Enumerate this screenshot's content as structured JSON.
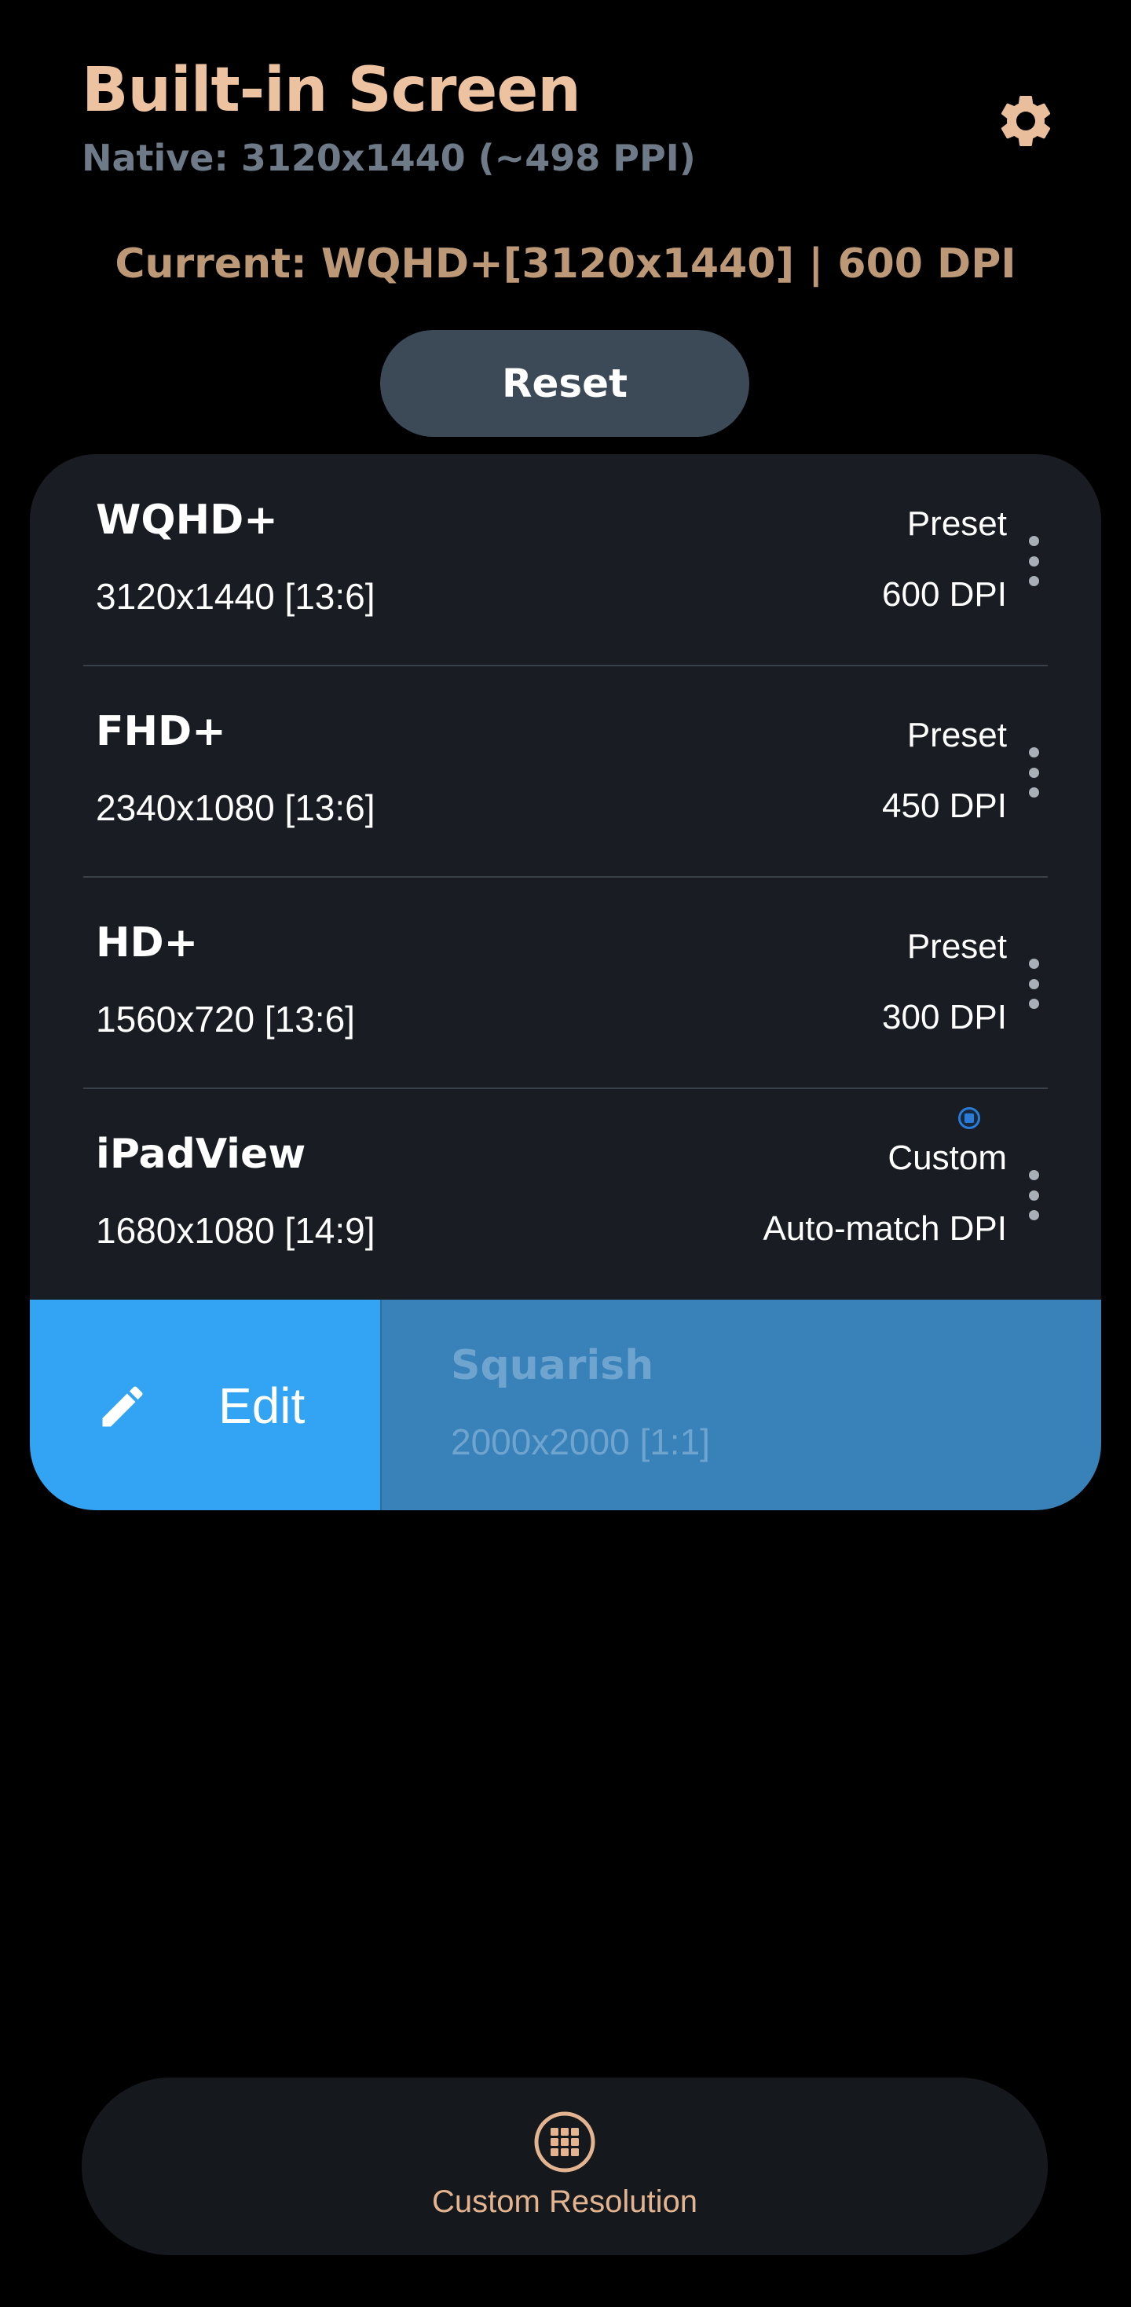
{
  "header": {
    "title": "Built-in Screen",
    "native": "Native: 3120x1440 (~498 PPI)",
    "settings_icon": "gear-icon"
  },
  "current": "Current: WQHD+[3120x1440] | 600 DPI",
  "reset_label": "Reset",
  "resolutions": [
    {
      "name": "WQHD+",
      "resolution": "3120x1440 [13:6]",
      "kind": "Preset",
      "dpi": "600 DPI"
    },
    {
      "name": "FHD+",
      "resolution": "2340x1080 [13:6]",
      "kind": "Preset",
      "dpi": "450 DPI"
    },
    {
      "name": "HD+",
      "resolution": "1560x720 [13:6]",
      "kind": "Preset",
      "dpi": "300 DPI"
    },
    {
      "name": "iPadView",
      "resolution": "1680x1080 [14:9]",
      "kind": "Custom",
      "dpi": "Auto-match DPI"
    }
  ],
  "swipe_item": {
    "edit_label": "Edit",
    "name": "Squarish",
    "resolution": "2000x2000 [1:1]"
  },
  "bottom_bar": {
    "label": "Custom Resolution",
    "icon": "grid-icon"
  },
  "colors": {
    "background": "#000000",
    "card": "#191D23",
    "title": "#EDC2A0",
    "current": "#BD9877",
    "edit_action": "#33A4F4",
    "swiped_row": "#3881B9",
    "reset_button": "#3C4956"
  }
}
